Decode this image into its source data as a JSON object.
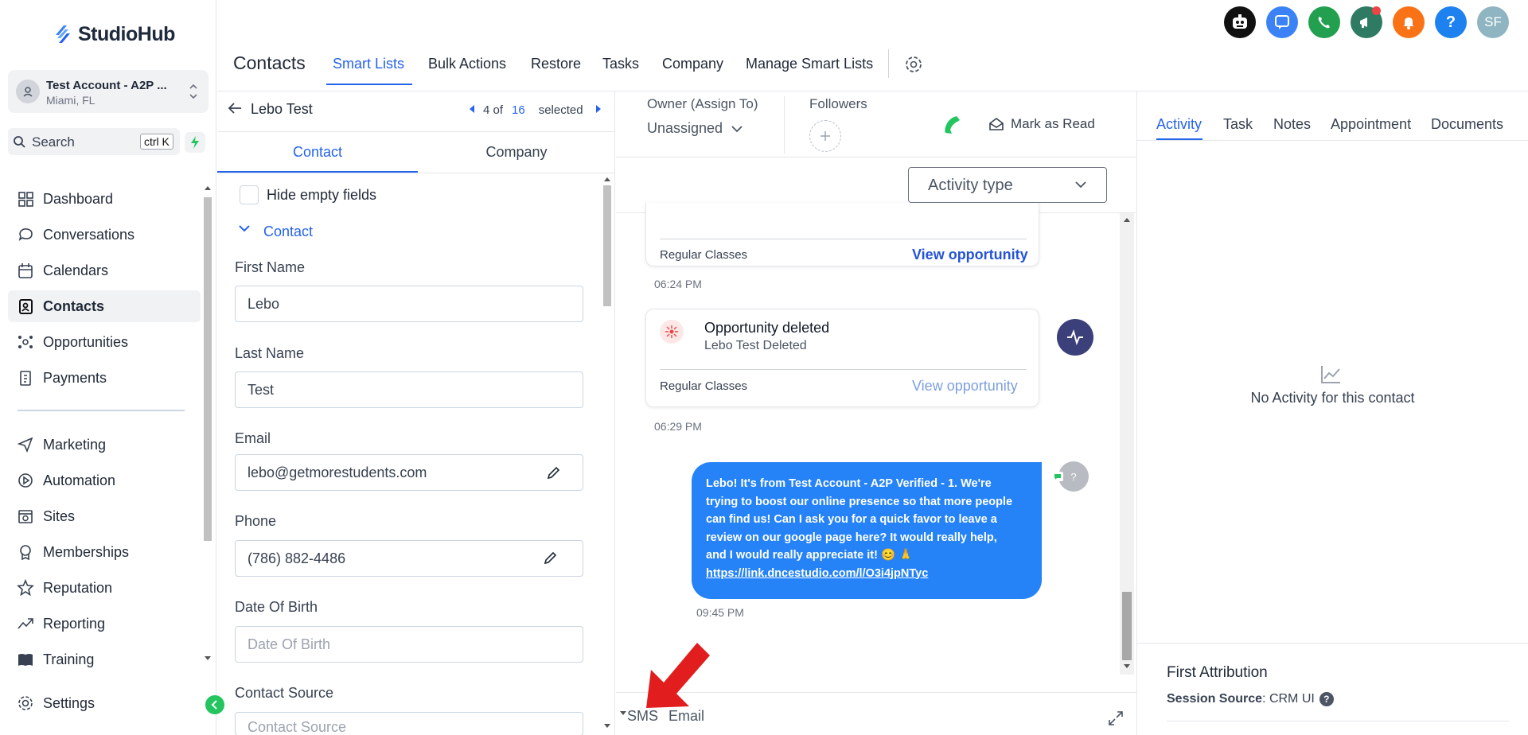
{
  "sidebar": {
    "logo": "StudioHub",
    "account_name": "Test Account - A2P ...",
    "account_location": "Miami, FL",
    "search_label": "Search",
    "search_shortcut": "ctrl K",
    "nav": [
      {
        "label": "Dashboard",
        "icon": "dashboard-icon"
      },
      {
        "label": "Conversations",
        "icon": "chat-icon"
      },
      {
        "label": "Calendars",
        "icon": "calendar-icon"
      },
      {
        "label": "Contacts",
        "icon": "contacts-icon",
        "active": true
      },
      {
        "label": "Opportunities",
        "icon": "opportunities-icon"
      },
      {
        "label": "Payments",
        "icon": "payments-icon"
      },
      {
        "label": "Marketing",
        "icon": "send-icon"
      },
      {
        "label": "Automation",
        "icon": "automation-icon"
      },
      {
        "label": "Sites",
        "icon": "sites-icon"
      },
      {
        "label": "Memberships",
        "icon": "membership-icon"
      },
      {
        "label": "Reputation",
        "icon": "star-icon"
      },
      {
        "label": "Reporting",
        "icon": "trend-icon"
      },
      {
        "label": "Training",
        "icon": "book-icon"
      }
    ],
    "settings_label": "Settings"
  },
  "header": {
    "title": "Contacts",
    "tabs": [
      "Smart Lists",
      "Bulk Actions",
      "Restore",
      "Tasks",
      "Company",
      "Manage Smart Lists"
    ],
    "active_tab": "Smart Lists",
    "avatar_initials": "SF",
    "help_label": "?"
  },
  "contact_panel": {
    "name": "Lebo Test",
    "pager_current": "4 of",
    "pager_total": "16",
    "pager_suffix": "selected",
    "tabs": [
      "Contact",
      "Company"
    ],
    "hide_empty_label": "Hide empty fields",
    "section_label": "Contact",
    "fields": {
      "first_name_label": "First Name",
      "first_name_value": "Lebo",
      "last_name_label": "Last Name",
      "last_name_value": "Test",
      "email_label": "Email",
      "email_value": "lebo@getmorestudents.com",
      "phone_label": "Phone",
      "phone_value": "(786) 882-4486",
      "dob_label": "Date Of Birth",
      "dob_placeholder": "Date Of Birth",
      "source_label": "Contact Source",
      "source_placeholder": "Contact Source"
    }
  },
  "conversation": {
    "owner_label": "Owner (Assign To)",
    "owner_value": "Unassigned",
    "followers_label": "Followers",
    "mark_read_label": "Mark as Read",
    "activity_type_label": "Activity type",
    "card1_pipeline": "Regular Classes",
    "card1_link": "View opportunity",
    "time1": "06:24 PM",
    "card2_title": "Opportunity deleted",
    "card2_subtitle": "Lebo Test Deleted",
    "card2_pipeline": "Regular Classes",
    "card2_link": "View opportunity",
    "time2": "06:29 PM",
    "sms_lines": [
      "Lebo! It's  from Test Account - A2P Verified - 1. We're",
      "trying to boost our online presence so that more people",
      "can find us! Can I ask you for a quick favor to leave a",
      "review on our google page here? It would really help,",
      "and I would really appreciate it! 😊 🙏"
    ],
    "sms_link": "https://link.dncestudio.com/l/O3i4jpNTyc",
    "time3": "09:45 PM",
    "sender_avatar": "?",
    "composer_tabs": [
      "SMS",
      "Email"
    ]
  },
  "right_panel": {
    "tabs": [
      "Activity",
      "Task",
      "Notes",
      "Appointment",
      "Documents"
    ],
    "active_tab": "Activity",
    "empty_text": "No Activity for this contact",
    "attribution_title": "First Attribution",
    "session_source_label": "Session Source",
    "session_source_value": "CRM UI"
  },
  "colors": {
    "accent": "#2563eb",
    "sms_bubble": "#2583f7",
    "top_icon_dark": "#111111",
    "top_icon_blue": "#3b82f6",
    "top_icon_green": "#22a050",
    "top_icon_teal": "#2f7a63",
    "top_icon_orange": "#f97316",
    "top_icon_help": "#1d82f0",
    "avatar_bg": "#8fb5c2",
    "arrow_red": "#e11d1d"
  }
}
